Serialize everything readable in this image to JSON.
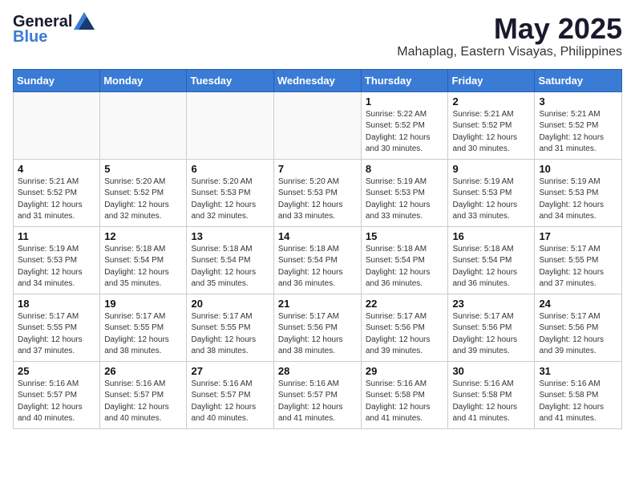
{
  "header": {
    "logo_general": "General",
    "logo_blue": "Blue",
    "month_title": "May 2025",
    "location": "Mahaplag, Eastern Visayas, Philippines"
  },
  "weekdays": [
    "Sunday",
    "Monday",
    "Tuesday",
    "Wednesday",
    "Thursday",
    "Friday",
    "Saturday"
  ],
  "weeks": [
    [
      {
        "day": "",
        "info": ""
      },
      {
        "day": "",
        "info": ""
      },
      {
        "day": "",
        "info": ""
      },
      {
        "day": "",
        "info": ""
      },
      {
        "day": "1",
        "info": "Sunrise: 5:22 AM\nSunset: 5:52 PM\nDaylight: 12 hours\nand 30 minutes."
      },
      {
        "day": "2",
        "info": "Sunrise: 5:21 AM\nSunset: 5:52 PM\nDaylight: 12 hours\nand 30 minutes."
      },
      {
        "day": "3",
        "info": "Sunrise: 5:21 AM\nSunset: 5:52 PM\nDaylight: 12 hours\nand 31 minutes."
      }
    ],
    [
      {
        "day": "4",
        "info": "Sunrise: 5:21 AM\nSunset: 5:52 PM\nDaylight: 12 hours\nand 31 minutes."
      },
      {
        "day": "5",
        "info": "Sunrise: 5:20 AM\nSunset: 5:52 PM\nDaylight: 12 hours\nand 32 minutes."
      },
      {
        "day": "6",
        "info": "Sunrise: 5:20 AM\nSunset: 5:53 PM\nDaylight: 12 hours\nand 32 minutes."
      },
      {
        "day": "7",
        "info": "Sunrise: 5:20 AM\nSunset: 5:53 PM\nDaylight: 12 hours\nand 33 minutes."
      },
      {
        "day": "8",
        "info": "Sunrise: 5:19 AM\nSunset: 5:53 PM\nDaylight: 12 hours\nand 33 minutes."
      },
      {
        "day": "9",
        "info": "Sunrise: 5:19 AM\nSunset: 5:53 PM\nDaylight: 12 hours\nand 33 minutes."
      },
      {
        "day": "10",
        "info": "Sunrise: 5:19 AM\nSunset: 5:53 PM\nDaylight: 12 hours\nand 34 minutes."
      }
    ],
    [
      {
        "day": "11",
        "info": "Sunrise: 5:19 AM\nSunset: 5:53 PM\nDaylight: 12 hours\nand 34 minutes."
      },
      {
        "day": "12",
        "info": "Sunrise: 5:18 AM\nSunset: 5:54 PM\nDaylight: 12 hours\nand 35 minutes."
      },
      {
        "day": "13",
        "info": "Sunrise: 5:18 AM\nSunset: 5:54 PM\nDaylight: 12 hours\nand 35 minutes."
      },
      {
        "day": "14",
        "info": "Sunrise: 5:18 AM\nSunset: 5:54 PM\nDaylight: 12 hours\nand 36 minutes."
      },
      {
        "day": "15",
        "info": "Sunrise: 5:18 AM\nSunset: 5:54 PM\nDaylight: 12 hours\nand 36 minutes."
      },
      {
        "day": "16",
        "info": "Sunrise: 5:18 AM\nSunset: 5:54 PM\nDaylight: 12 hours\nand 36 minutes."
      },
      {
        "day": "17",
        "info": "Sunrise: 5:17 AM\nSunset: 5:55 PM\nDaylight: 12 hours\nand 37 minutes."
      }
    ],
    [
      {
        "day": "18",
        "info": "Sunrise: 5:17 AM\nSunset: 5:55 PM\nDaylight: 12 hours\nand 37 minutes."
      },
      {
        "day": "19",
        "info": "Sunrise: 5:17 AM\nSunset: 5:55 PM\nDaylight: 12 hours\nand 38 minutes."
      },
      {
        "day": "20",
        "info": "Sunrise: 5:17 AM\nSunset: 5:55 PM\nDaylight: 12 hours\nand 38 minutes."
      },
      {
        "day": "21",
        "info": "Sunrise: 5:17 AM\nSunset: 5:56 PM\nDaylight: 12 hours\nand 38 minutes."
      },
      {
        "day": "22",
        "info": "Sunrise: 5:17 AM\nSunset: 5:56 PM\nDaylight: 12 hours\nand 39 minutes."
      },
      {
        "day": "23",
        "info": "Sunrise: 5:17 AM\nSunset: 5:56 PM\nDaylight: 12 hours\nand 39 minutes."
      },
      {
        "day": "24",
        "info": "Sunrise: 5:17 AM\nSunset: 5:56 PM\nDaylight: 12 hours\nand 39 minutes."
      }
    ],
    [
      {
        "day": "25",
        "info": "Sunrise: 5:16 AM\nSunset: 5:57 PM\nDaylight: 12 hours\nand 40 minutes."
      },
      {
        "day": "26",
        "info": "Sunrise: 5:16 AM\nSunset: 5:57 PM\nDaylight: 12 hours\nand 40 minutes."
      },
      {
        "day": "27",
        "info": "Sunrise: 5:16 AM\nSunset: 5:57 PM\nDaylight: 12 hours\nand 40 minutes."
      },
      {
        "day": "28",
        "info": "Sunrise: 5:16 AM\nSunset: 5:57 PM\nDaylight: 12 hours\nand 41 minutes."
      },
      {
        "day": "29",
        "info": "Sunrise: 5:16 AM\nSunset: 5:58 PM\nDaylight: 12 hours\nand 41 minutes."
      },
      {
        "day": "30",
        "info": "Sunrise: 5:16 AM\nSunset: 5:58 PM\nDaylight: 12 hours\nand 41 minutes."
      },
      {
        "day": "31",
        "info": "Sunrise: 5:16 AM\nSunset: 5:58 PM\nDaylight: 12 hours\nand 41 minutes."
      }
    ]
  ]
}
